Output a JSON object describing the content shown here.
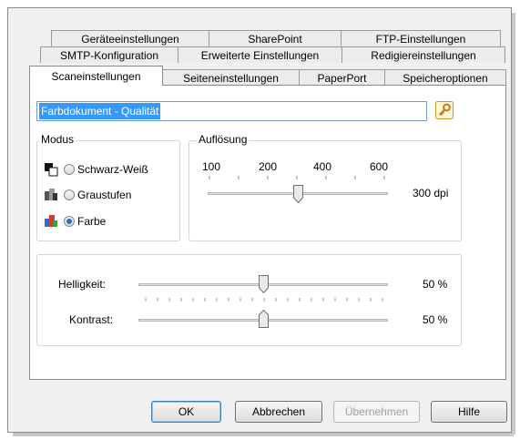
{
  "tabs": {
    "row1": [
      "Geräteeinstellungen",
      "SharePoint",
      "FTP-Einstellungen"
    ],
    "row2": [
      "SMTP-Konfiguration",
      "Erweiterte Einstellungen",
      "Redigiereinstellungen"
    ],
    "row3": [
      "Scaneinstellungen",
      "Seiteneinstellungen",
      "PaperPort",
      "Speicheroptionen"
    ],
    "active": "Scaneinstellungen"
  },
  "preset": {
    "value": "Farbdokument - Qualität",
    "icon": "key-icon"
  },
  "modus": {
    "title": "Modus",
    "options": [
      {
        "label": "Schwarz-Weiß",
        "icon": "bw-mode-icon",
        "checked": false
      },
      {
        "label": "Graustufen",
        "icon": "grayscale-mode-icon",
        "checked": false
      },
      {
        "label": "Farbe",
        "icon": "color-mode-icon",
        "checked": true
      }
    ]
  },
  "resolution": {
    "title": "Auflösung",
    "ticks": [
      "100",
      "200",
      "400",
      "600"
    ],
    "value_label": "300 dpi",
    "value": 300
  },
  "adjustments": {
    "brightness": {
      "label": "Helligkeit:",
      "value_label": "50 %",
      "value": 50
    },
    "contrast": {
      "label": "Kontrast:",
      "value_label": "50 %",
      "value": 50
    }
  },
  "buttons": {
    "ok": "OK",
    "cancel": "Abbrechen",
    "apply": "Übernehmen",
    "help": "Hilfe"
  },
  "colors": {
    "selection": "#3399ff",
    "radio_checked": "#1f6fd1"
  }
}
